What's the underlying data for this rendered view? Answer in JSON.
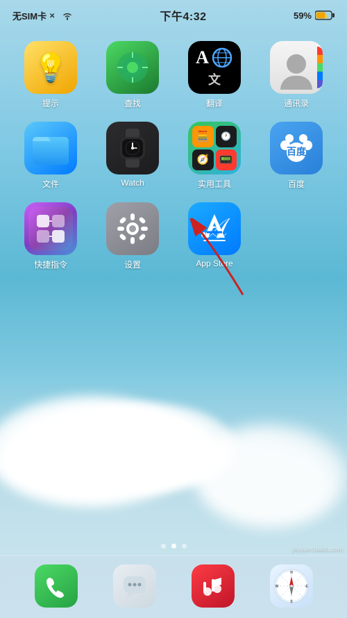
{
  "statusBar": {
    "carrier": "无SIM卡",
    "time": "下午4:32",
    "battery": "59%"
  },
  "apps": {
    "row1": [
      {
        "id": "reminders",
        "label": "提示",
        "icon": "reminders"
      },
      {
        "id": "find",
        "label": "查找",
        "icon": "find"
      },
      {
        "id": "translate",
        "label": "翻译",
        "icon": "translate"
      },
      {
        "id": "contacts",
        "label": "通讯录",
        "icon": "contacts"
      }
    ],
    "row2": [
      {
        "id": "files",
        "label": "文件",
        "icon": "files"
      },
      {
        "id": "watch",
        "label": "Watch",
        "icon": "watch"
      },
      {
        "id": "utilities",
        "label": "实用工具",
        "icon": "utilities"
      },
      {
        "id": "baidu",
        "label": "百度",
        "icon": "baidu"
      }
    ],
    "row3": [
      {
        "id": "shortcuts",
        "label": "快捷指令",
        "icon": "shortcuts"
      },
      {
        "id": "settings",
        "label": "设置",
        "icon": "settings"
      },
      {
        "id": "appstore",
        "label": "App Store",
        "icon": "appstore"
      }
    ]
  },
  "dock": [
    {
      "id": "phone",
      "icon": "phone"
    },
    {
      "id": "messages",
      "icon": "messages"
    },
    {
      "id": "music",
      "icon": "music"
    },
    {
      "id": "safari",
      "icon": "safari"
    }
  ],
  "pageDots": [
    {
      "active": false
    },
    {
      "active": true
    },
    {
      "active": false
    }
  ],
  "watermark": "jituyam.baidu.com"
}
